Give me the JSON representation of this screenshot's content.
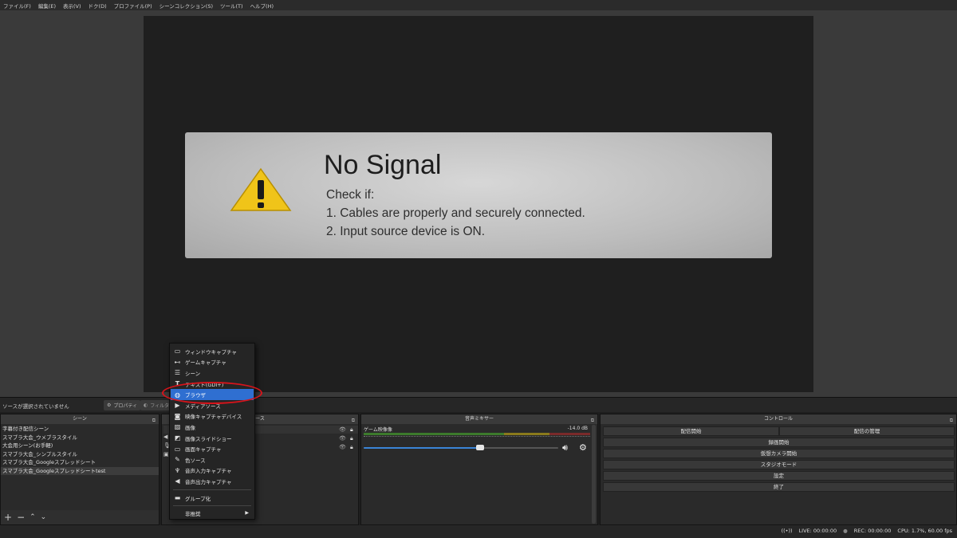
{
  "menu": [
    "ファイル(F)",
    "編集(E)",
    "表示(V)",
    "ドク(D)",
    "プロファイル(P)",
    "シーンコレクション(S)",
    "ツール(T)",
    "ヘルプ(H)"
  ],
  "preview": {
    "title": "No Signal",
    "lines": [
      "Check if:",
      "1. Cables are properly and securely connected.",
      "2. Input source device is ON."
    ]
  },
  "source_bar": {
    "text": "ソースが選択されていません",
    "properties": "プロパティ",
    "filters": "フィルタ"
  },
  "scenes": {
    "title": "シーン",
    "items": [
      "字幕付き配信シーン",
      "スマブラ大会_ウメブラスタイル",
      "大会用シーン(お手軽)",
      "スマブラ大会_シンプルスタイル",
      "スマブラ大会_Googleスプレッドシート",
      "スマブラ大会_Googleスプレッドシートtest"
    ],
    "selected_index": 5
  },
  "sources": {
    "title": "ース"
  },
  "mixer": {
    "title": "音声ミキサー",
    "track": "ゲーム映像像",
    "db": "-14.0 dB",
    "volume_fraction": 0.6
  },
  "controls": {
    "title": "コントロール",
    "start_stream": "配信開始",
    "manage_stream": "配信の管理",
    "start_recording": "録画開始",
    "start_virtualcam": "仮想カメラ開始",
    "studio_mode": "スタジオモード",
    "settings": "設定",
    "exit": "終了"
  },
  "status": {
    "live": "LIVE: 00:00:00",
    "rec": "REC: 00:00:00",
    "cpu": "CPU: 1.7%, 60.00 fps"
  },
  "context_menu": {
    "items": [
      {
        "icon": "window-icon",
        "label": "ウィンドウキャプチャ"
      },
      {
        "icon": "gamepad-icon",
        "label": "ゲームキャプチャ"
      },
      {
        "icon": "list-icon",
        "label": "シーン"
      },
      {
        "icon": "text-icon",
        "label": "テキスト(GDI+)"
      },
      {
        "icon": "globe-icon",
        "label": "ブラウザ"
      },
      {
        "icon": "play-icon",
        "label": "メディアソース"
      },
      {
        "icon": "camera-icon",
        "label": "映像キャプチャデバイス"
      },
      {
        "icon": "image-icon",
        "label": "画像"
      },
      {
        "icon": "slideshow-icon",
        "label": "画像スライドショー"
      },
      {
        "icon": "monitor-icon",
        "label": "画面キャプチャ"
      },
      {
        "icon": "brush-icon",
        "label": "色ソース"
      },
      {
        "icon": "mic-icon",
        "label": "音声入力キャプチャ"
      },
      {
        "icon": "speaker-icon",
        "label": "音声出力キャプチャ"
      }
    ],
    "group": "グループ化",
    "deprecated": "非推奨",
    "highlight_index": 4
  }
}
